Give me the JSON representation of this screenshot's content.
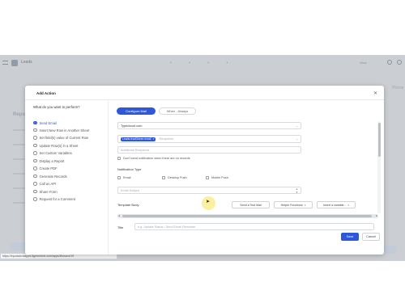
{
  "app": {
    "title": "Leads",
    "view_tag": "View",
    "sidebar_heading": "Repo",
    "right_edge_text": "Phone"
  },
  "status_url": "https://eportalxmlapps.ttgmenhed.com/apps/l/lonaco/19",
  "modal": {
    "title": "Add Action",
    "question": "What do you want to perform?",
    "close_icon": "close-icon",
    "actions": [
      {
        "label": "Send Email",
        "selected": true
      },
      {
        "label": "Insert New Row in Another Sheet",
        "selected": false
      },
      {
        "label": "Set field(s) value of Current Row",
        "selected": false
      },
      {
        "label": "Update Row(s) in a Sheet",
        "selected": false
      },
      {
        "label": "Set Custom Variables",
        "selected": false
      },
      {
        "label": "Display a Report",
        "selected": false
      },
      {
        "label": "Create PDF",
        "selected": false
      },
      {
        "label": "Generate Records",
        "selected": false
      },
      {
        "label": "Call an API",
        "selected": false
      },
      {
        "label": "Share Form",
        "selected": false
      },
      {
        "label": "Request for a Comment",
        "selected": false
      }
    ],
    "tabs": {
      "active": "Configure Mail",
      "inactive": "When - Always"
    },
    "from_field": "Typecircuit.com",
    "recipient_chip": "Leads.leadOwner.email",
    "recipients_placeholder": "Recipients",
    "additional_recipients_placeholder": "Additional Recipients",
    "dont_send_label": "Don't send notification when there are no records",
    "notification_type": {
      "label": "Notification Type",
      "options": [
        "Email",
        "Desktop Push",
        "Mobile Push"
      ]
    },
    "email_subject_placeholder": "Email Subject",
    "template_body_label": "Template Body",
    "send_test_mail": "Send a Test Mail",
    "helper_functions": "Helper Functions",
    "insert_variable": "Insert a variable...",
    "title_label": "Title",
    "title_placeholder": "e.g. Update Status / Send Email Reminder",
    "save": "Save",
    "cancel": "Cancel"
  },
  "colors": {
    "accent": "#2f58d8",
    "cursor_highlight": "#f6e450"
  }
}
